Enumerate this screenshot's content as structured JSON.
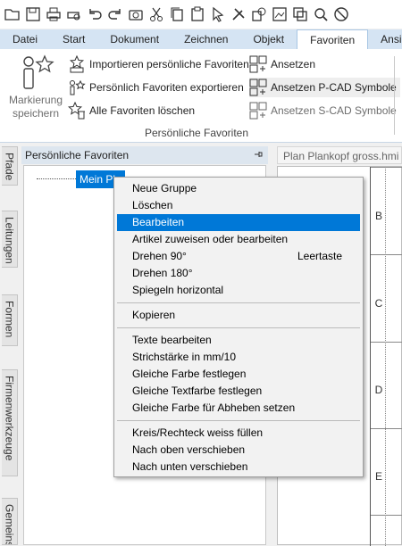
{
  "toolbar": {
    "icons": [
      "open-folder-icon",
      "save-icon",
      "print-icon",
      "print-preview-icon",
      "undo-icon",
      "redo-icon",
      "camera-icon",
      "cut-icon",
      "copy-icon",
      "paste-icon",
      "pointer-icon",
      "tools-icon",
      "shapes-icon",
      "gallery-icon",
      "layers-icon",
      "zoom-icon",
      "no-entry-icon"
    ]
  },
  "ribbon_tabs": [
    "Datei",
    "Start",
    "Dokument",
    "Zeichnen",
    "Objekt",
    "Favoriten",
    "Ansic"
  ],
  "ribbon_active_tab": "Favoriten",
  "ribbon": {
    "mark_button_label_1": "Markierung",
    "mark_button_label_2": "speichern",
    "import": "Importieren persönliche Favoriten",
    "export": "Persönlich Favoriten exportieren",
    "delete_all": "Alle Favoriten löschen",
    "attach": "Ansetzen",
    "attach_pcad": "Ansetzen P-CAD Symbole",
    "attach_scad": "Ansetzen S-CAD Symbole",
    "group_label": "Persönliche Favoriten"
  },
  "side_tabs": [
    "Pfade",
    "Leitungen",
    "Formen",
    "Firmenwerkzeuge",
    "Gemeins"
  ],
  "panel": {
    "title": "Persönliche Favoriten",
    "tree_node": "Mein Pla"
  },
  "drawing": {
    "tab_title": "Plan Plankopf gross.hmi",
    "row_labels": [
      "B",
      "C",
      "D",
      "E"
    ]
  },
  "context_menu": {
    "groups": [
      [
        {
          "label": "Neue Gruppe"
        },
        {
          "label": "Löschen"
        },
        {
          "label": "Bearbeiten",
          "selected": true
        },
        {
          "label": "Artikel zuweisen oder bearbeiten"
        },
        {
          "label": "Drehen 90°",
          "shortcut": "Leertaste"
        },
        {
          "label": "Drehen 180°"
        },
        {
          "label": "Spiegeln horizontal"
        }
      ],
      [
        {
          "label": "Kopieren"
        }
      ],
      [
        {
          "label": "Texte bearbeiten"
        },
        {
          "label": "Strichstärke in mm/10"
        },
        {
          "label": "Gleiche Farbe festlegen"
        },
        {
          "label": "Gleiche Textfarbe festlegen"
        },
        {
          "label": "Gleiche Farbe für Abheben setzen"
        }
      ],
      [
        {
          "label": "Kreis/Rechteck weiss füllen"
        },
        {
          "label": "Nach oben verschieben"
        },
        {
          "label": "Nach unten verschieben"
        }
      ]
    ]
  },
  "colors": {
    "selection": "#0078d7",
    "tabbar": "#d5e4f3",
    "panel_header": "#dde6ef"
  }
}
